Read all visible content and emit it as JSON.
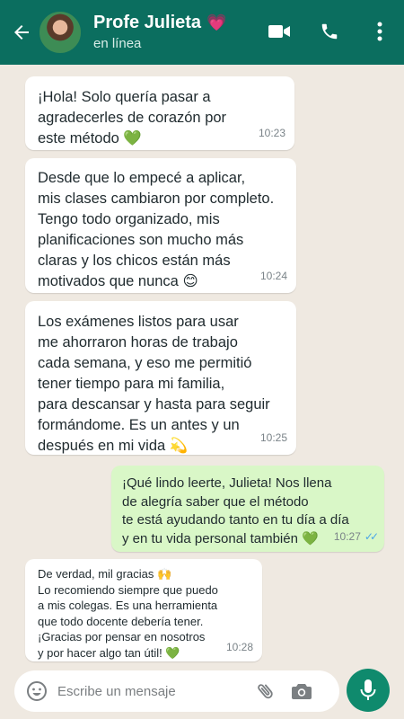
{
  "colors": {
    "header": "#0b6e5f",
    "background": "#efe9e1",
    "outgoing": "#d9f7c7",
    "accent": "#0f8a6d",
    "read_ticks": "#4aa6e8"
  },
  "header": {
    "contact_name": "Profe Julieta",
    "status": "en línea",
    "icons": [
      "back-arrow-icon",
      "video-call-icon",
      "phone-icon",
      "more-options-icon"
    ]
  },
  "messages": [
    {
      "dir": "in",
      "text": "¡Hola! Solo quería pasar a\nagradecerles de corazón por\neste método",
      "emoji": "💚",
      "time": "10:23"
    },
    {
      "dir": "in",
      "text": "Desde que lo empecé a aplicar,\nmis clases cambiaron por completo.\nTengo todo organizado, mis\nplanificaciones son mucho más\nclaras y los chicos están más\nmotivados que nunca",
      "emoji": "😊",
      "time": "10:24"
    },
    {
      "dir": "in",
      "text": "Los exámenes listos para usar\nme ahorraron horas de trabajo\ncada semana, y eso me permitió\ntener tiempo para mi familia,\npara descansar y hasta para seguir\nformándome. Es un antes y un\ndespués en mi vida",
      "emoji": "💫",
      "time": "10:25"
    },
    {
      "dir": "out",
      "text": "¡Qué lindo leerte, Julieta! Nos llena\nde alegría saber que el método\nte está ayudando tanto en tu día a día\ny en tu vida personal también",
      "emoji": "💚",
      "time": "10:27",
      "ticks": "✓✓"
    },
    {
      "dir": "in",
      "text": "De verdad, mil gracias",
      "text2": "Lo recomiendo siempre que puedo\na mis colegas. Es una herramienta\nque todo docente debería tener.\n¡Gracias por pensar en nosotros\ny por hacer algo tan útil!",
      "emoji": "🙌",
      "emoji2": "💚",
      "time": "10:28"
    }
  ],
  "composer": {
    "placeholder": "Escribe un mensaje"
  }
}
